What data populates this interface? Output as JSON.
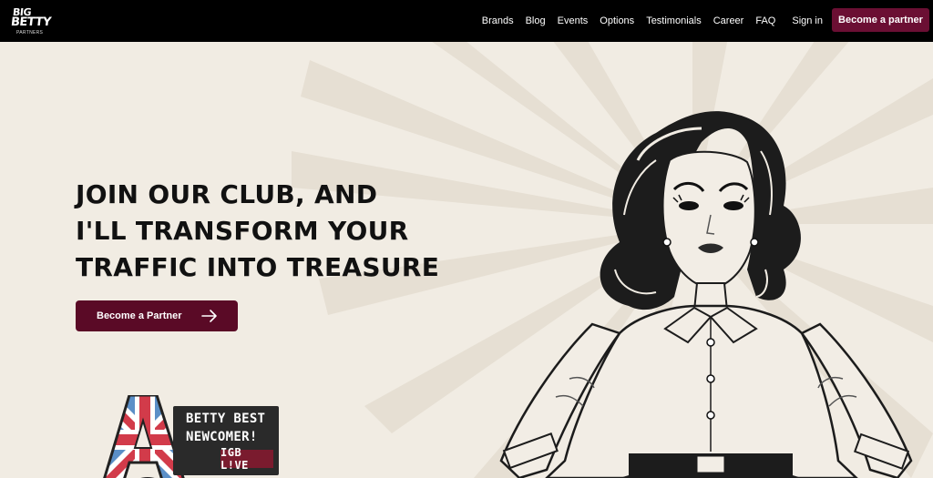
{
  "brand": {
    "line1": "BIG",
    "line2": "BETTY",
    "line3": "PARTNERS"
  },
  "nav": {
    "links": [
      "Brands",
      "Blog",
      "Events",
      "Options",
      "Testimonials",
      "Career",
      "FAQ"
    ],
    "signin": "Sign in",
    "cta": "Become a partner"
  },
  "hero": {
    "headline": [
      "JOIN OUR CLUB, AND",
      "I'LL TRANSFORM YOUR",
      "TRAFFIC INTO TREASURE"
    ],
    "button_label": "Become a Partner"
  },
  "badge": {
    "line1": "BETTY BEST",
    "line2": "NEWCOMER!",
    "tag": "IGB L!VE"
  },
  "colors": {
    "nav_bg": "#000000",
    "accent": "#6b0f33",
    "hero_bg": "#f1ece3"
  }
}
